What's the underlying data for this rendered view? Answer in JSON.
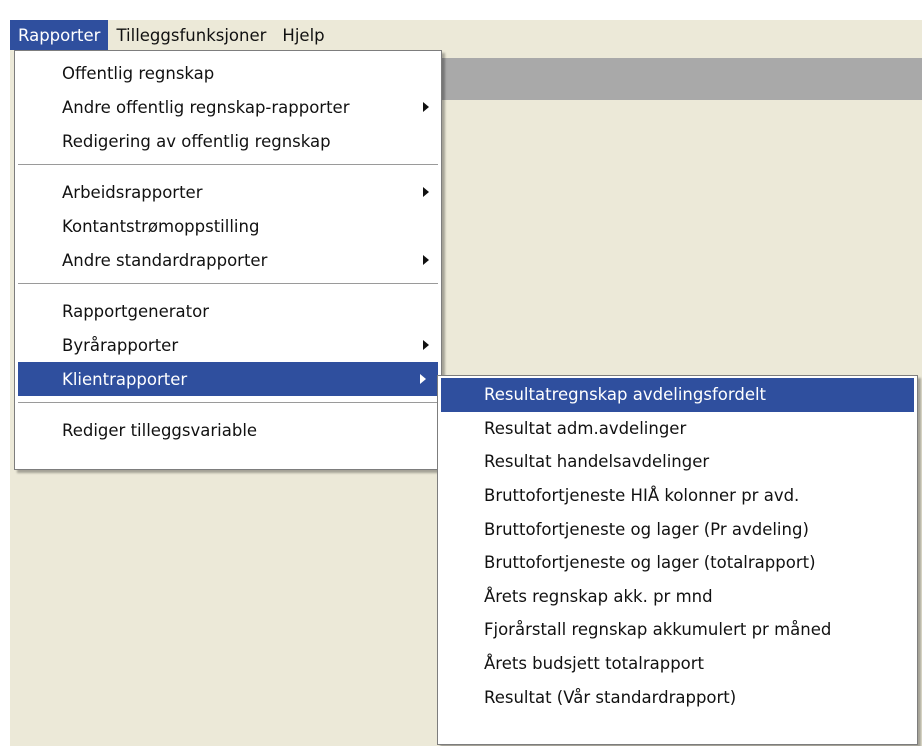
{
  "menubar": {
    "items": [
      "Rapporter",
      "Tilleggsfunksjoner",
      "Hjelp"
    ]
  },
  "main_menu": {
    "groups": [
      [
        "Offentlig regnskap",
        "Andre offentlig regnskap-rapporter",
        "Redigering av offentlig regnskap"
      ],
      [
        "Arbeidsrapporter",
        "Kontantstrømoppstilling",
        "Andre standardrapporter"
      ],
      [
        "Rapportgenerator",
        "Byrårapporter",
        "Klientrapporter"
      ],
      [
        "Rediger tilleggsvariable"
      ]
    ]
  },
  "sub_menu": {
    "items": [
      "Resultatregnskap avdelingsfordelt",
      "Resultat adm.avdelinger",
      "Resultat handelsavdelinger",
      "Bruttofortjeneste HIÅ kolonner pr avd.",
      "Bruttofortjeneste og lager (Pr avdeling)",
      "Bruttofortjeneste og lager (totalrapport)",
      "Årets regnskap akk. pr mnd",
      "Fjorårstall regnskap akkumulert pr måned",
      "Årets budsjett totalrapport",
      "Resultat (Vår standardrapport)"
    ]
  },
  "colors": {
    "highlight": "#2f4f9e",
    "background": "#ece9d8",
    "menu_bg": "#ffffff"
  }
}
